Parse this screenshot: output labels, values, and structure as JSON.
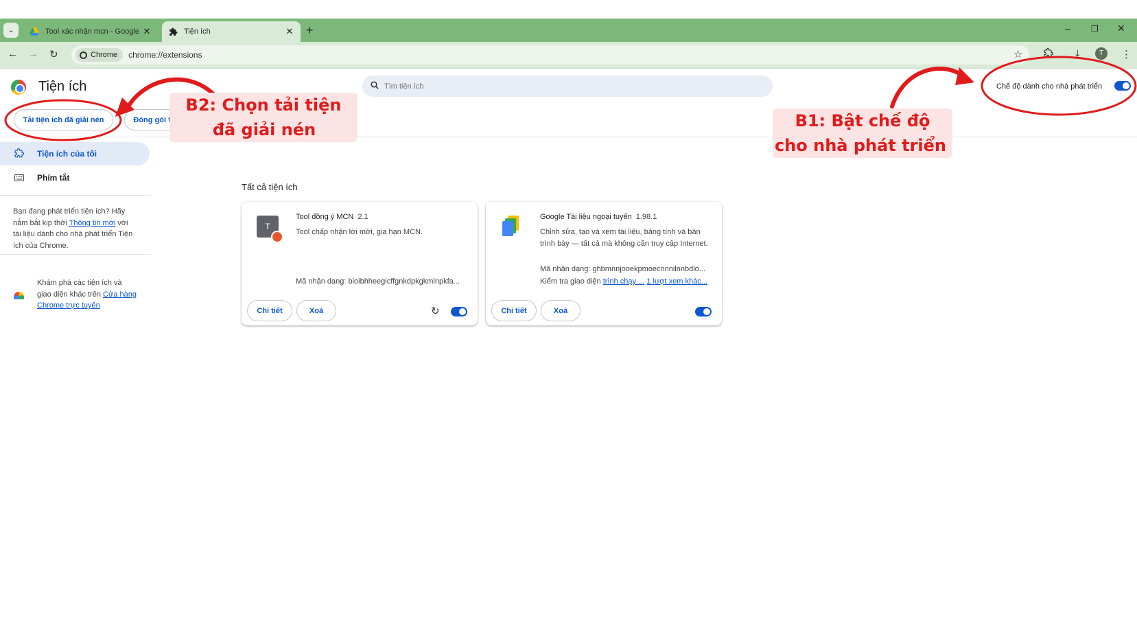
{
  "browser": {
    "tabs": [
      {
        "title": "Tool xác nhận mcn - Google Dr",
        "icon": "google-drive-icon",
        "active": false
      },
      {
        "title": "Tiện ích",
        "icon": "puzzle-icon",
        "active": true
      }
    ],
    "chip_label": "Chrome",
    "url": "chrome://extensions",
    "avatar_letter": "T",
    "theme_color": "#7cb87a"
  },
  "header": {
    "title": "Tiện ích",
    "search_placeholder": "Tìm tiện ích",
    "dev_mode_label": "Chế độ dành cho nhà phát triển",
    "dev_mode_on": true
  },
  "actions": {
    "load_unpacked": "Tải tiện ích đã giải nén",
    "pack_extension": "Đóng gói tiện ích"
  },
  "sidebar": {
    "items": [
      {
        "label": "Tiện ích của tôi",
        "icon": "puzzle-outline-icon",
        "selected": true
      },
      {
        "label": "Phím tắt",
        "icon": "keyboard-icon",
        "selected": false
      }
    ],
    "dev_promo": {
      "before_link": "Bạn đang phát triển tiện ích? Hãy nắm bắt kịp thời ",
      "link": "Thông tin mới",
      "after_link": " với tài liệu dành cho nhà phát triển Tiện ích của Chrome."
    },
    "store_promo": {
      "before_link": "Khám phá các tiện ích và giao diện khác trên ",
      "link": "Cửa hàng Chrome trực tuyến"
    }
  },
  "main": {
    "section_title": "Tất cả tiện ích",
    "extensions": [
      {
        "name": "Tool đồng ý MCN",
        "version": "2.1",
        "description": "Tool chấp nhận lời mời, gia hạn MCN.",
        "id_line": "Mã nhận dạng: bioibhheegicffgnkdpkgkmlnpkfa...",
        "details_label": "Chi tiết",
        "remove_label": "Xoá",
        "enabled": true,
        "icon_letter": "T"
      },
      {
        "name": "Google Tài liệu ngoại tuyến",
        "version": "1.98.1",
        "description": "Chỉnh sửa, tạo và xem tài liệu, bảng tính và bản trình bày — tất cả mà không cần truy cập Internet.",
        "id_line": "Mã nhận dạng: ghbmnnjooekpmoecnnnilnnbdlo...",
        "inspect_label": "Kiểm tra giao diện",
        "inspect_link1": "trình chạy ...",
        "inspect_link2": "1 lượt xem khác...",
        "details_label": "Chi tiết",
        "remove_label": "Xoá",
        "enabled": true
      }
    ]
  },
  "annotations": {
    "step2_line1": "B2: Chọn tải tiện ích",
    "step2_line2": "đã giải nén",
    "step1_line1": "B1: Bật chế độ dành",
    "step1_line2": "cho nhà phát triển",
    "color": "#e01b1b"
  }
}
